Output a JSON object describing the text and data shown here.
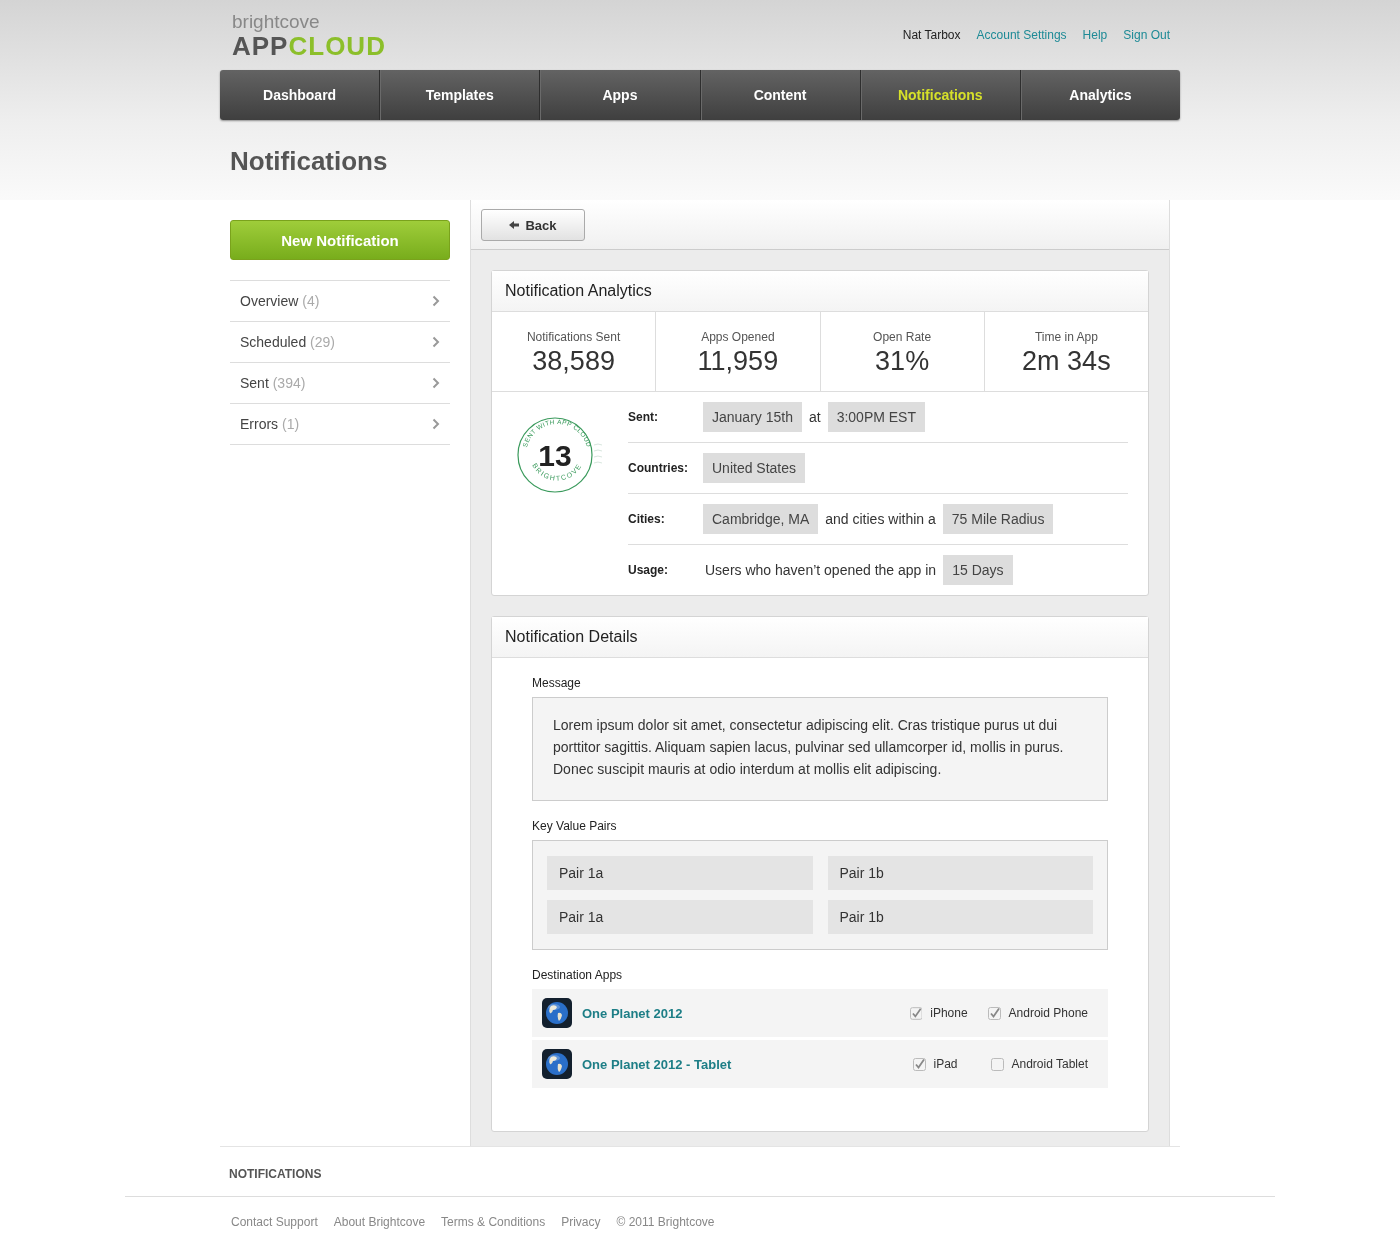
{
  "logo": {
    "top": "brightcove",
    "word1": "APP",
    "word2": "CLOUD"
  },
  "user_links": [
    {
      "label": "Nat Tarbox",
      "kind": "user"
    },
    {
      "label": "Account Settings",
      "kind": "link"
    },
    {
      "label": "Help",
      "kind": "link"
    },
    {
      "label": "Sign Out",
      "kind": "link"
    }
  ],
  "nav": [
    {
      "label": "Dashboard",
      "selected": false
    },
    {
      "label": "Templates",
      "selected": false
    },
    {
      "label": "Apps",
      "selected": false
    },
    {
      "label": "Content",
      "selected": false
    },
    {
      "label": "Notifications",
      "selected": true
    },
    {
      "label": "Analytics",
      "selected": false
    }
  ],
  "page_title": "Notifications",
  "new_button": "New Notification",
  "sidebar": [
    {
      "label": "Overview",
      "count": "(4)"
    },
    {
      "label": "Scheduled",
      "count": "(29)"
    },
    {
      "label": "Sent",
      "count": "(394)"
    },
    {
      "label": "Errors",
      "count": "(1)"
    }
  ],
  "back_button": "Back",
  "analytics": {
    "title": "Notification Analytics",
    "stats": [
      {
        "label": "Notifications Sent",
        "value": "38,589"
      },
      {
        "label": "Apps Opened",
        "value": "11,959"
      },
      {
        "label": "Open Rate",
        "value": "31%"
      },
      {
        "label": "Time in App",
        "value": "2m 34s"
      }
    ],
    "stamp": {
      "top": "SENT WITH APP CLOUD",
      "number": "13",
      "bottom": "BRIGHTCOVE"
    },
    "rows": [
      {
        "label": "Sent:",
        "parts": [
          {
            "kind": "tag",
            "text": "January 15th"
          },
          {
            "kind": "text",
            "text": "at"
          },
          {
            "kind": "tag",
            "text": "3:00PM EST"
          }
        ]
      },
      {
        "label": "Countries:",
        "parts": [
          {
            "kind": "tag",
            "text": "United States"
          }
        ]
      },
      {
        "label": "Cities:",
        "parts": [
          {
            "kind": "tag",
            "text": "Cambridge, MA"
          },
          {
            "kind": "text",
            "text": "and cities within a"
          },
          {
            "kind": "tag",
            "text": "75 Mile Radius"
          }
        ]
      },
      {
        "label": "Usage:",
        "parts": [
          {
            "kind": "text",
            "text": "Users who haven’t opened the app in"
          },
          {
            "kind": "tag",
            "text": "15 Days"
          }
        ]
      }
    ]
  },
  "details": {
    "title": "Notification Details",
    "message_label": "Message",
    "message": "Lorem ipsum dolor sit amet, consectetur adipiscing elit. Cras tristique purus ut dui porttitor sagittis. Aliquam sapien lacus, pulvinar sed ullamcorper id, mollis in purus. Donec suscipit mauris at odio interdum at mollis elit adipiscing.",
    "pairs_label": "Key Value Pairs",
    "pairs": [
      {
        "key": "Pair 1a",
        "value": "Pair 1b"
      },
      {
        "key": "Pair 1a",
        "value": "Pair 1b"
      }
    ],
    "apps_label": "Destination Apps",
    "apps": [
      {
        "name": "One Planet 2012",
        "devices": [
          {
            "label": "iPhone",
            "checked": true
          },
          {
            "label": "Android Phone",
            "checked": true
          }
        ]
      },
      {
        "name": "One Planet 2012 - Tablet",
        "devices": [
          {
            "label": "iPad",
            "checked": true
          },
          {
            "label": "Android Tablet",
            "checked": false
          }
        ]
      }
    ]
  },
  "footer": {
    "section": "NOTIFICATIONS",
    "links": [
      "Contact Support",
      "About Brightcove",
      "Terms & Conditions",
      "Privacy",
      "© 2011 Brightcove"
    ]
  }
}
